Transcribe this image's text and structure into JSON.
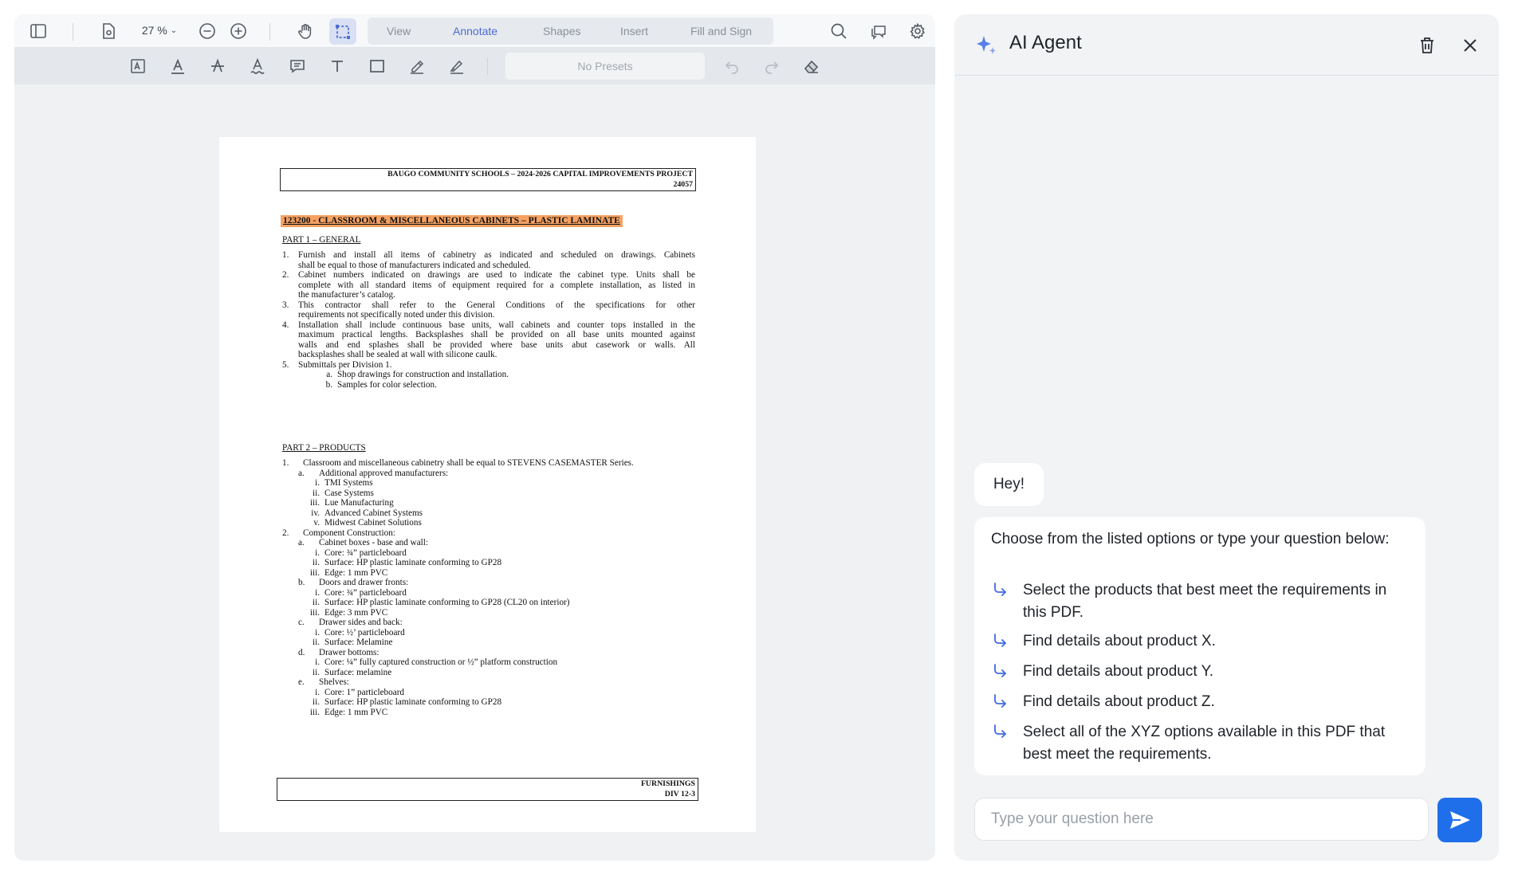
{
  "viewer": {
    "zoom": "27 %",
    "tabs": [
      "View",
      "Annotate",
      "Shapes",
      "Insert",
      "Fill and Sign"
    ],
    "active_tab": "Annotate",
    "presets": "No Presets"
  },
  "document": {
    "header_line1": "BAUGO COMMUNITY SCHOOLS – 2024-2026 CAPITAL IMPROVEMENTS PROJECT",
    "header_line2": "24057",
    "title": "123200 - CLASSROOM & MISCELLANEOUS CABINETS – PLASTIC LAMINATE",
    "part1": "PART 1 – GENERAL",
    "p1_items": [
      {
        "n": "1.",
        "lines": [
          "Furnish and install all items of cabinetry as indicated and scheduled on drawings.  Cabinets",
          "shall be equal to those of manufacturers indicated and scheduled."
        ]
      },
      {
        "n": "2.",
        "lines": [
          "Cabinet numbers indicated on drawings are used to indicate the cabinet type.  Units shall be",
          "complete with all standard items of equipment required for a complete installation, as listed in",
          "the manufacturer’s catalog."
        ]
      },
      {
        "n": "3.",
        "lines": [
          "This contractor shall refer to the General Conditions of the specifications for other",
          "requirements not specifically noted under this division."
        ]
      },
      {
        "n": "4.",
        "lines": [
          "Installation shall include continuous base units, wall cabinets and counter tops installed in the",
          "maximum practical lengths.  Backsplashes shall be provided on all base units mounted against",
          "walls and end splashes shall be provided where base units abut casework or walls.  All",
          "backsplashes shall be sealed at wall with silicone caulk."
        ]
      },
      {
        "n": "5.",
        "lines": [
          "Submittals per Division 1."
        ]
      }
    ],
    "p1_sub": [
      {
        "m": "a.",
        "t": "Shop drawings for construction and installation."
      },
      {
        "m": "b.",
        "t": "Samples for color selection."
      }
    ],
    "part2": "PART 2 – PRODUCTS",
    "p2_lines": [
      {
        "lvl": 0,
        "m": "1.",
        "t": "Classroom and miscellaneous cabinetry shall be equal to STEVENS CASEMASTER Series."
      },
      {
        "lvl": 1,
        "m": "a.",
        "t": "Additional approved manufacturers:"
      },
      {
        "lvl": 2,
        "m": "i.",
        "t": "TMI Systems"
      },
      {
        "lvl": 2,
        "m": "ii.",
        "t": "Case Systems"
      },
      {
        "lvl": 2,
        "m": "iii.",
        "t": "Lue Manufacturing"
      },
      {
        "lvl": 2,
        "m": "iv.",
        "t": "Advanced Cabinet Systems"
      },
      {
        "lvl": 2,
        "m": "v.",
        "t": "Midwest Cabinet Solutions"
      },
      {
        "lvl": 0,
        "m": "2.",
        "t": "Component Construction:"
      },
      {
        "lvl": 1,
        "m": "a.",
        "t": "Cabinet boxes - base and wall:"
      },
      {
        "lvl": 2,
        "m": "i.",
        "t": "Core: ¾” particleboard"
      },
      {
        "lvl": 2,
        "m": "ii.",
        "t": "Surface: HP plastic laminate conforming to GP28"
      },
      {
        "lvl": 2,
        "m": "iii.",
        "t": "Edge: 1 mm PVC"
      },
      {
        "lvl": 1,
        "m": "b.",
        "t": "Doors and drawer fronts:"
      },
      {
        "lvl": 2,
        "m": "i.",
        "t": "Core: ¾” particleboard"
      },
      {
        "lvl": 2,
        "m": "ii.",
        "t": "Surface: HP plastic laminate conforming to GP28 (CL20 on interior)"
      },
      {
        "lvl": 2,
        "m": "iii.",
        "t": "Edge: 3 mm PVC"
      },
      {
        "lvl": 1,
        "m": "c.",
        "t": "Drawer sides and back:"
      },
      {
        "lvl": 2,
        "m": "i.",
        "t": "Core: ½’ particleboard"
      },
      {
        "lvl": 2,
        "m": "ii.",
        "t": "Surface: Melamine"
      },
      {
        "lvl": 1,
        "m": "d.",
        "t": "Drawer bottoms:"
      },
      {
        "lvl": 2,
        "m": "i.",
        "t": "Core: ¼” fully captured construction or ½” platform construction"
      },
      {
        "lvl": 2,
        "m": "ii.",
        "t": "Surface: melamine"
      },
      {
        "lvl": 1,
        "m": "e.",
        "t": "Shelves:"
      },
      {
        "lvl": 2,
        "m": "i.",
        "t": "Core: 1” particleboard"
      },
      {
        "lvl": 2,
        "m": "ii.",
        "t": "Surface: HP plastic laminate conforming to GP28"
      },
      {
        "lvl": 2,
        "m": "iii.",
        "t": "Edge: 1 mm PVC"
      }
    ],
    "footer_line1": "FURNISHINGS",
    "footer_line2": "DIV 12-3"
  },
  "ai": {
    "title": "AI Agent",
    "greeting": "Hey!",
    "intro": "Choose from the listed options or type your question below:",
    "options": [
      "Select the products that best meet the requirements in this PDF.",
      "Find details about product X.",
      "Find details about product Y.",
      "Find details about product Z.",
      "Select all of the XYZ options available in this PDF that best meet the requirements."
    ],
    "input_placeholder": "Type your question here"
  },
  "colors": {
    "accent": "#4b6cd2",
    "send_button": "#1f6feb",
    "title_highlight": "#f6a263",
    "option_arrow": "#4169e1"
  }
}
